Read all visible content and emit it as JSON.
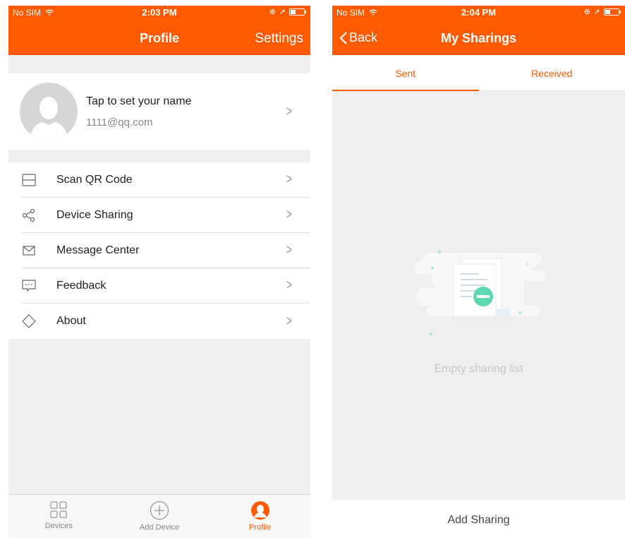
{
  "profile_screen": {
    "status": {
      "carrier": "No SIM",
      "time": "2:03 PM"
    },
    "nav": {
      "title": "Profile",
      "settings_label": "Settings"
    },
    "user": {
      "name_prompt": "Tap to set your name",
      "email": "1111@qq.com"
    },
    "menu": [
      {
        "label": "Scan QR Code",
        "icon": "scan-icon"
      },
      {
        "label": "Device Sharing",
        "icon": "share-icon"
      },
      {
        "label": "Message Center",
        "icon": "mail-icon"
      },
      {
        "label": "Feedback",
        "icon": "feedback-icon"
      },
      {
        "label": "About",
        "icon": "about-icon"
      }
    ],
    "tabbar": [
      {
        "label": "Devices",
        "icon": "grid-icon"
      },
      {
        "label": "Add Device",
        "icon": "plus-circle-icon"
      },
      {
        "label": "Profile",
        "icon": "profile-icon",
        "active": true
      }
    ]
  },
  "sharing_screen": {
    "status": {
      "carrier": "No SIM",
      "time": "2:04 PM"
    },
    "nav": {
      "back_label": "Back",
      "title": "My Sharings"
    },
    "tabs": [
      {
        "label": "Sent",
        "active": true
      },
      {
        "label": "Received",
        "active": false
      }
    ],
    "empty_text": "Empty sharing list",
    "add_label": "Add Sharing"
  },
  "colors": {
    "accent": "#ff5a00",
    "background": "#efefef",
    "empty_icon": "#5fd8b2"
  }
}
